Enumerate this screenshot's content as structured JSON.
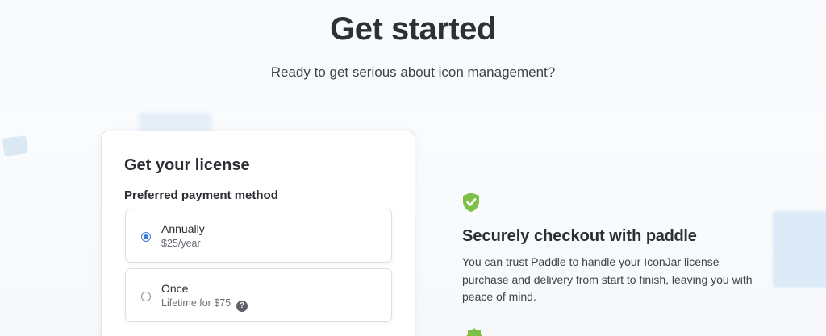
{
  "hero": {
    "title": "Get started",
    "subtitle": "Ready to get serious about icon management?"
  },
  "license_card": {
    "title": "Get your license",
    "payment_label": "Preferred payment method",
    "options": [
      {
        "name": "Annually",
        "price": "$25/year",
        "selected": true
      },
      {
        "name": "Once",
        "price": "Lifetime for $75",
        "selected": false,
        "help_icon": "question-mark"
      }
    ]
  },
  "trust": {
    "icon": "shield-check-icon",
    "title_prefix": "Securely checkout with",
    "brand": "paddle",
    "description": "You can trust Paddle to handle your IconJar license purchase and delivery from start to finish, leaving you with peace of mind."
  },
  "colors": {
    "accent_blue": "#3b7be0",
    "shield_green": "#7cc146"
  }
}
